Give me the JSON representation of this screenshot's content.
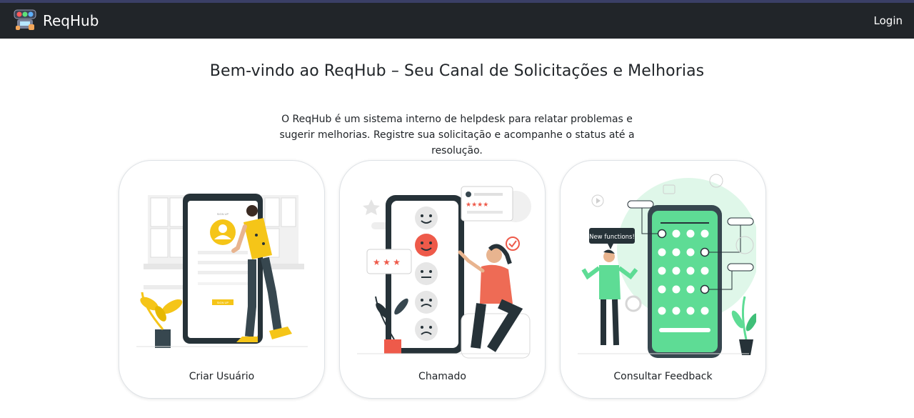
{
  "navbar": {
    "brand": "ReqHub",
    "logo_icon": "robot-logo-icon",
    "login_label": "Login"
  },
  "hero": {
    "title": "Bem-vindo ao ReqHub – Seu Canal de Solicitações e Melhorias",
    "description": "O ReqHub é um sistema interno de helpdesk para relatar problemas e sugerir melhorias. Registre sua solicitação e acompanhe o status até a resolução."
  },
  "cards": [
    {
      "label": "Criar Usuário",
      "illustration": "signup-illustration"
    },
    {
      "label": "Chamado",
      "illustration": "feedback-rating-illustration"
    },
    {
      "label": "Consultar Feedback",
      "illustration": "new-functions-illustration"
    }
  ],
  "illustration_text": {
    "new_functions": "New functions!"
  },
  "colors": {
    "navbar": "#212529",
    "accent_yellow": "#f5c518",
    "accent_red": "#ee5a4a",
    "accent_green": "#5edc95"
  }
}
